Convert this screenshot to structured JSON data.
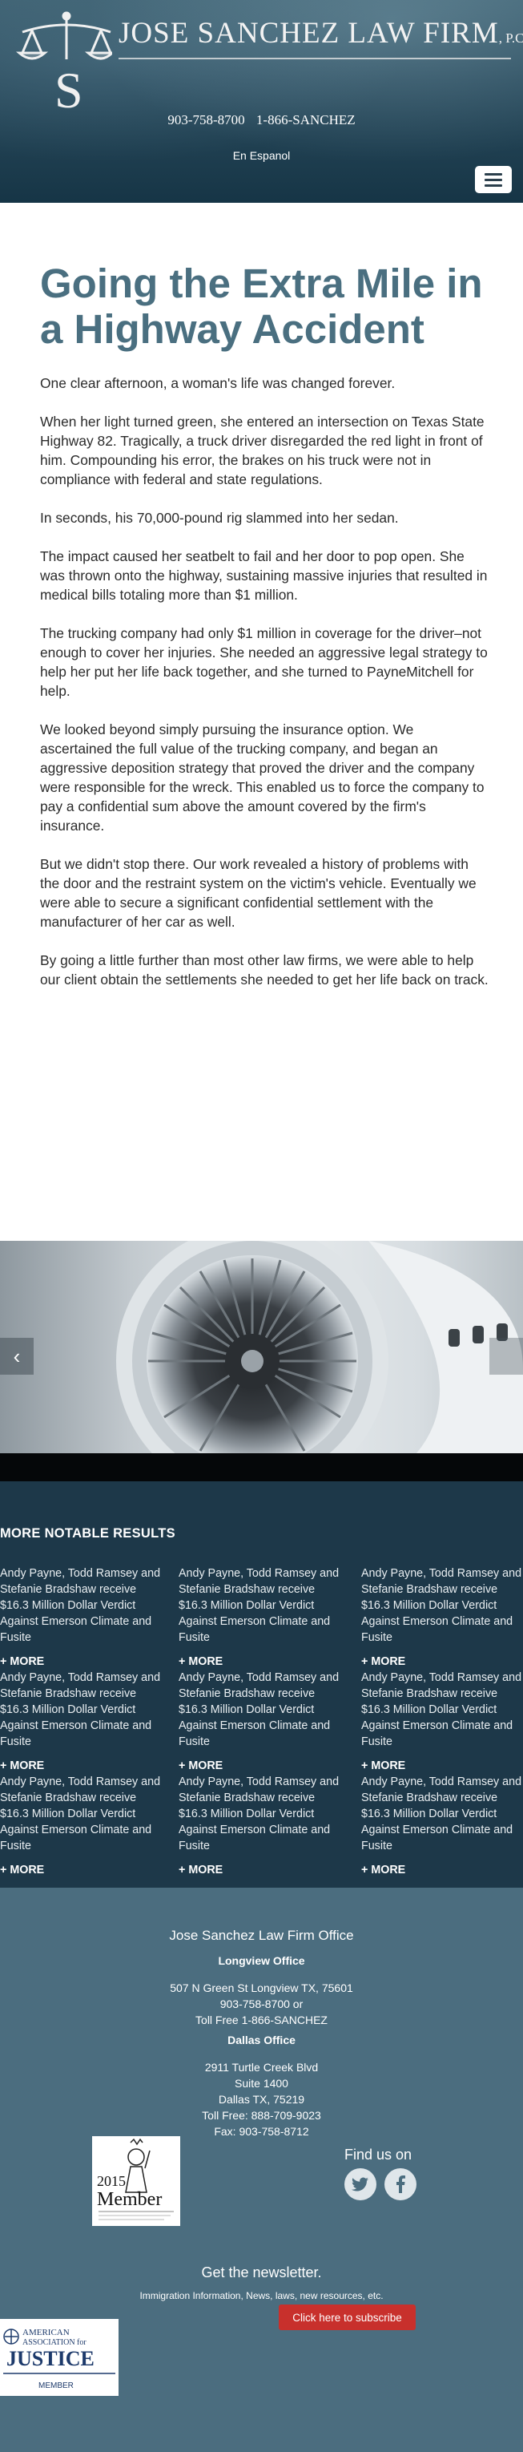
{
  "header": {
    "firm_name": "JOSE SANCHEZ LAW FIRM",
    "firm_suffix": "P.C.",
    "logo_letter": "S",
    "phone_1": "903-758-8700",
    "phone_2": "1-866-SANCHEZ",
    "language_link": "En Espanol",
    "menu_icon": "hamburger-menu-icon"
  },
  "article": {
    "title": "Going the Extra Mile in a Highway Accident",
    "paragraphs": [
      "One clear afternoon, a woman's life was changed forever.",
      "When her light turned green, she entered an intersection on Texas State Highway 82. Tragically, a truck driver disregarded the red light in front of him. Compounding his error, the brakes on his truck were not in compliance with federal and state regulations.",
      "In seconds, his 70,000-pound rig slammed into her sedan.",
      "The impact caused her seatbelt to fail and her door to pop open. She was thrown onto the highway, sustaining massive injuries that resulted in medical bills totaling more than $1 million.",
      "The trucking company had only $1 million in coverage for the driver–not enough to cover her injuries. She needed an aggressive legal strategy to help her put her life back together, and she turned to PayneMitchell for help.",
      "We looked beyond simply pursuing the insurance option. We ascertained the full value of the trucking company, and began an aggressive deposition strategy that proved the driver and the company were responsible for the wreck. This enabled us to force the company to pay a confidential sum above the amount covered by the firm's insurance.",
      "But we didn't stop there. Our work revealed a history of problems with the door and the restraint system on the victim's vehicle. Eventually we were able to secure a significant confidential settlement with the manufacturer of her car as well.",
      "By going a little further than most other law firms, we were able to help our client obtain the settlements she needed to get her life back on track."
    ]
  },
  "slider": {
    "prev_arrow": "‹"
  },
  "results": {
    "heading": "MORE NOTABLE RESULTS",
    "more_label": "+ MORE",
    "items": [
      "Andy Payne, Todd Ramsey and Stefanie Bradshaw receive $16.3 Million Dollar Verdict Against Emerson Climate and Fusite",
      "Andy Payne, Todd Ramsey and Stefanie Bradshaw receive $16.3 Million Dollar Verdict Against Emerson Climate and Fusite",
      "Andy Payne, Todd Ramsey and Stefanie Bradshaw receive $16.3 Million Dollar Verdict Against Emerson Climate and Fusite",
      "Andy Payne, Todd Ramsey and Stefanie Bradshaw receive $16.3 Million Dollar Verdict Against Emerson Climate and Fusite",
      "Andy Payne, Todd Ramsey and Stefanie Bradshaw receive $16.3 Million Dollar Verdict Against Emerson Climate and Fusite",
      "Andy Payne, Todd Ramsey and Stefanie Bradshaw receive $16.3 Million Dollar Verdict Against Emerson Climate and Fusite",
      "Andy Payne, Todd Ramsey and Stefanie Bradshaw receive $16.3 Million Dollar Verdict Against Emerson Climate and Fusite",
      "Andy Payne, Todd Ramsey and Stefanie Bradshaw receive $16.3 Million Dollar Verdict Against Emerson Climate and Fusite",
      "Andy Payne, Todd Ramsey and Stefanie Bradshaw receive $16.3 Million Dollar Verdict Against Emerson Climate and Fusite"
    ]
  },
  "footer": {
    "office_title": "Jose Sanchez Law Firm Office",
    "longview": {
      "label": "Longview Office",
      "address": "507 N Green St Longview TX, 75601",
      "phone": "903-758-8700 or",
      "toll_free": "Toll Free 1-866-SANCHEZ"
    },
    "dallas": {
      "label": "Dallas Office",
      "address_1": "2911 Turtle Creek Blvd",
      "address_2": "Suite 1400",
      "address_3": "Dallas TX, 75219",
      "toll_free": "Toll Free: 888-709-9023",
      "fax": "Fax: 903-758-8712"
    },
    "find_us": "Find us on",
    "twitter_icon": "twitter-icon",
    "facebook_icon": "facebook-icon",
    "badge_year": "2015",
    "badge_word": "Member",
    "newsletter_title": "Get the newsletter.",
    "newsletter_desc": "Immigration Information, News, laws, new resources, etc.",
    "subscribe_label": "Click here to subscribe",
    "aaj_line1": "AMERICAN",
    "aaj_line2": "ASSOCIATION for",
    "aaj_line3": "JUSTICE",
    "aaj_line4": "MEMBER"
  },
  "colors": {
    "header_bg": "#1f4152",
    "title_blue": "#4a6f80",
    "results_bg": "#1d3849",
    "footer_bg": "#4b6d7f",
    "subscribe_red": "#c8302c"
  }
}
